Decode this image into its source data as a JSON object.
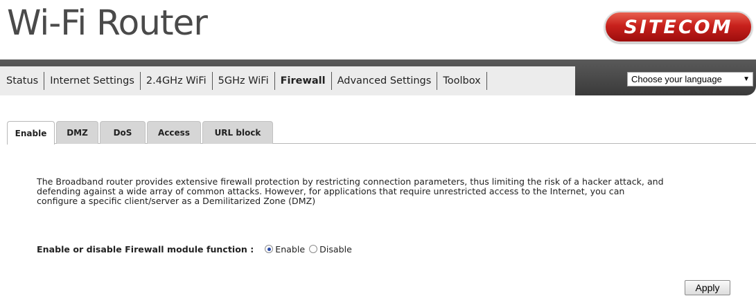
{
  "header": {
    "title": "Wi-Fi Router",
    "logo_text": "SITECOM"
  },
  "nav": {
    "items": [
      {
        "label": "Status"
      },
      {
        "label": "Internet Settings"
      },
      {
        "label": "2.4GHz WiFi"
      },
      {
        "label": "5GHz WiFi"
      },
      {
        "label": "Firewall"
      },
      {
        "label": "Advanced Settings"
      },
      {
        "label": "Toolbox"
      }
    ],
    "active": "Firewall",
    "language_select": {
      "value": "Choose your language"
    }
  },
  "tabs": {
    "items": [
      {
        "label": "Enable"
      },
      {
        "label": "DMZ"
      },
      {
        "label": "DoS"
      },
      {
        "label": "Access"
      },
      {
        "label": "URL block"
      }
    ],
    "active": "Enable"
  },
  "content": {
    "description_lines": [
      "The Broadband router provides extensive firewall protection by restricting connection parameters, thus limiting the risk of a hacker attack, and",
      "defending against a wide array of common attacks. However, for applications that require unrestricted access to the Internet, you can",
      "configure a specific client/server as a Demilitarized Zone (DMZ)"
    ],
    "firewall_label": "Enable or disable Firewall module function :",
    "options": [
      {
        "label": "Enable",
        "checked": true
      },
      {
        "label": "Disable",
        "checked": false
      }
    ],
    "apply_label": "Apply"
  },
  "colors": {
    "logo_red": "#c8211c",
    "nav_dark": "#3a3a3a",
    "radio_dot": "#2a4aa8"
  }
}
